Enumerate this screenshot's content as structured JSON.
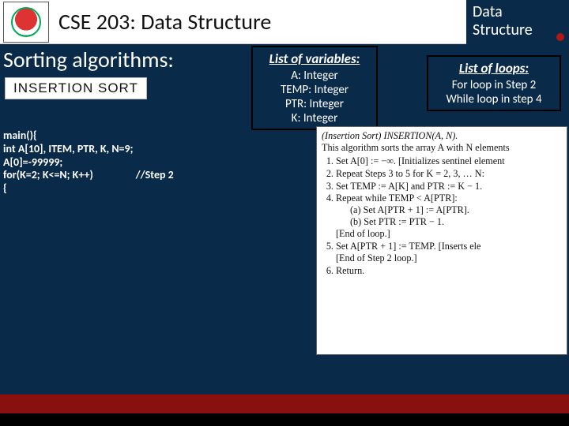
{
  "header": {
    "title": "CSE 203: Data Structure",
    "corner_line1": "Data",
    "corner_line2": "Structure"
  },
  "section": {
    "heading": "Sorting algorithms:",
    "chip": "INSERTION SORT"
  },
  "vars": {
    "hdr": "List of variables:",
    "l1": "A: Integer",
    "l2": "TEMP: Integer",
    "l3": "PTR: Integer",
    "l4": "K: Integer"
  },
  "loops": {
    "hdr": "List of loops:",
    "l1": "For loop in Step 2",
    "l2": "While loop in step 4"
  },
  "code": "main(){\nint A[10], ITEM, PTR, K, N=9;\nA[0]=-99999;\nfor(K=2; K<=N; K++)                 //Step 2\n{",
  "algo": {
    "l0": "(Insertion Sort) INSERTION(A, N).",
    "l1": "This algorithm sorts the array A with N elements",
    "s1": "Set A[0] := −∞. [Initializes sentinel element",
    "s2": "Repeat Steps 3 to 5 for K = 2, 3, … N:",
    "s3": "    Set TEMP := A[K] and PTR := K − 1.",
    "s4": "    Repeat while TEMP < A[PTR]:",
    "s4a": "        (a) Set A[PTR + 1] := A[PTR].",
    "s4b": "        (b) Set PTR := PTR − 1.",
    "s4e": "    [End of loop.]",
    "s5": "    Set A[PTR + 1] := TEMP. [Inserts ele",
    "s5e": "[End of Step 2 loop.]",
    "s6": "Return."
  }
}
